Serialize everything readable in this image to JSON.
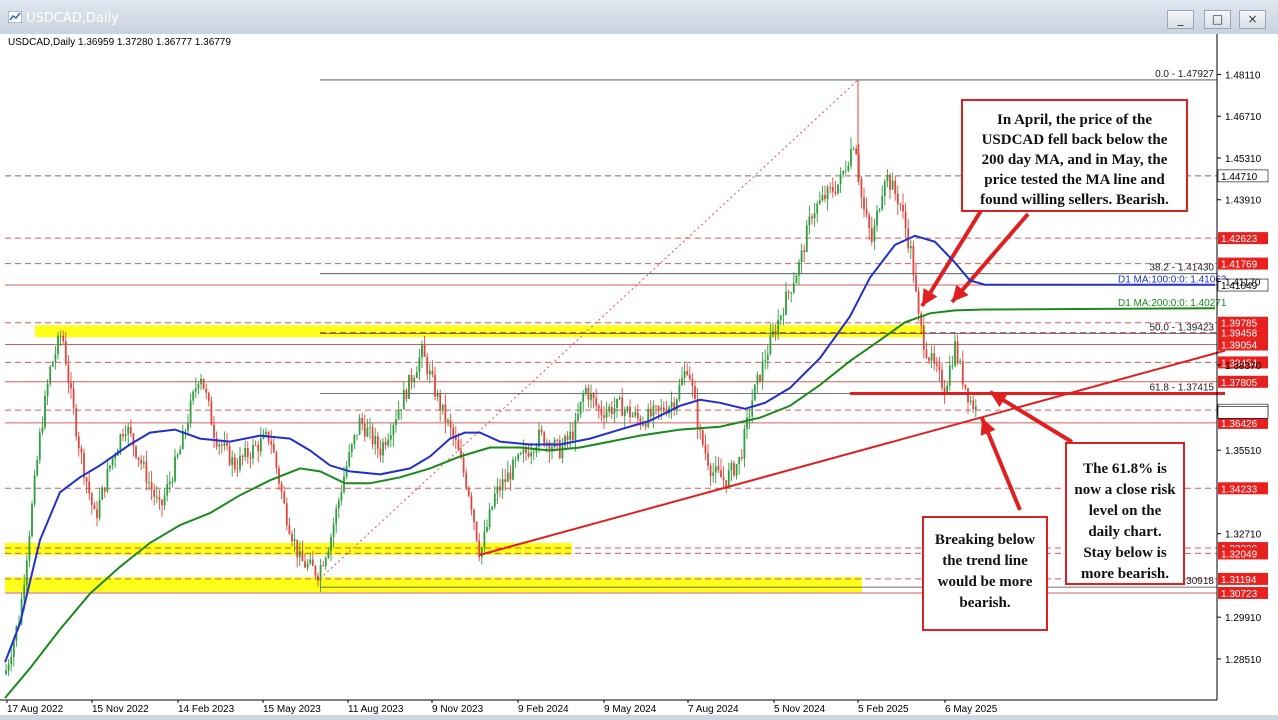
{
  "window": {
    "title": "USDCAD,Daily",
    "buttons": {
      "minimize": "_",
      "restore": "□",
      "close": "×"
    }
  },
  "chart_data": {
    "type": "line",
    "style": "candlestick",
    "symbol_header": "USDCAD,Daily  1.36959 1.37280 1.36777 1.36779",
    "ylim": [
      1.272,
      1.492
    ],
    "grid": false,
    "x_tick_labels": [
      "17 Aug 2022",
      "15 Nov 2022",
      "14 Feb 2023",
      "15 May 2023",
      "11 Aug 2023",
      "9 Nov 2023",
      "9 Feb 2024",
      "9 May 2024",
      "7 Aug 2024",
      "5 Nov 2024",
      "5 Feb 2025",
      "6 May 2025"
    ],
    "y_tick_labels": [
      "1.48110",
      "1.46710",
      "1.45310",
      "1.43910",
      "1.41170",
      "1.38370",
      "1.35510",
      "1.32710",
      "1.29910",
      "1.28510"
    ],
    "y_tick_values": [
      1.4811,
      1.4671,
      1.4531,
      1.4391,
      1.4117,
      1.3837,
      1.3551,
      1.3271,
      1.2991,
      1.2851
    ],
    "price_levels": [
      {
        "label": "1.44710",
        "value": 1.4471,
        "style": "dash",
        "color": "#555555"
      },
      {
        "label": "1.42623",
        "value": 1.42623,
        "style": "dash",
        "color": "#d04040"
      },
      {
        "label": "1.41769",
        "value": 1.41769,
        "style": "dash",
        "color": "#d04040"
      },
      {
        "label": "1.41049",
        "value": 1.41049,
        "style": "solid",
        "color": "#d04040"
      },
      {
        "label": "1.39785",
        "value": 1.39785,
        "style": "dash",
        "color": "#d04040"
      },
      {
        "label": "1.39458",
        "value": 1.39458,
        "style": "dash",
        "color": "#d04040"
      },
      {
        "label": "1.39054",
        "value": 1.39054,
        "style": "solid",
        "color": "#d04040"
      },
      {
        "label": "1.38454",
        "value": 1.38454,
        "style": "dash",
        "color": "#d04040"
      },
      {
        "label": "1.37805",
        "value": 1.37805,
        "style": "solid",
        "color": "#d04040"
      },
      {
        "label": "1.36853",
        "value": 1.36853,
        "style": "dash",
        "color": "#d04040"
      },
      {
        "label": "1.36426",
        "value": 1.36426,
        "style": "solid",
        "color": "#d04040"
      },
      {
        "label": "1.34233",
        "value": 1.34233,
        "style": "dash",
        "color": "#d04040"
      },
      {
        "label": "1.32229",
        "value": 1.32229,
        "style": "dash",
        "color": "#d04040"
      },
      {
        "label": "1.32049",
        "value": 1.32049,
        "style": "dash",
        "color": "#d04040"
      },
      {
        "label": "1.31194",
        "value": 1.31194,
        "style": "dash",
        "color": "#d04040"
      },
      {
        "label": "1.30723",
        "value": 1.30723,
        "style": "solid",
        "color": "#d04040"
      }
    ],
    "fib_levels": [
      {
        "label": "0.0 - 1.47927",
        "value": 1.47927
      },
      {
        "label": "38.2 - 1.41430",
        "value": 1.4143
      },
      {
        "label": "50.0 - 1.39423",
        "value": 1.39423
      },
      {
        "label": "61.8 - 1.37415",
        "value": 1.37415
      },
      {
        "label": "100.0 - 1.30918",
        "value": 1.30918
      }
    ],
    "ma_labels": [
      {
        "label": "D1 MA:100:0:0: 1.41063",
        "value": 1.41063,
        "color": "#1f2fd0"
      },
      {
        "label": "D1 MA:200:0:0: 1.40271",
        "value": 1.40271,
        "color": "#1a8a1a"
      }
    ],
    "current_price": {
      "label": "1.36779",
      "value": 1.36779
    },
    "highlight_levels": [
      1.4471,
      1.41049,
      1.36853
    ],
    "series": [
      {
        "name": "MA 100",
        "color": "#1f2fd0",
        "points": [
          [
            5,
            1.284
          ],
          [
            20,
            1.297
          ],
          [
            40,
            1.325
          ],
          [
            60,
            1.341
          ],
          [
            80,
            1.346
          ],
          [
            100,
            1.35
          ],
          [
            130,
            1.357
          ],
          [
            150,
            1.361
          ],
          [
            175,
            1.362
          ],
          [
            200,
            1.359
          ],
          [
            230,
            1.358
          ],
          [
            260,
            1.36
          ],
          [
            290,
            1.359
          ],
          [
            310,
            1.355
          ],
          [
            330,
            1.35
          ],
          [
            350,
            1.348
          ],
          [
            380,
            1.347
          ],
          [
            410,
            1.349
          ],
          [
            430,
            1.353
          ],
          [
            450,
            1.359
          ],
          [
            465,
            1.361
          ],
          [
            480,
            1.361
          ],
          [
            500,
            1.358
          ],
          [
            530,
            1.357
          ],
          [
            560,
            1.357
          ],
          [
            590,
            1.359
          ],
          [
            620,
            1.362
          ],
          [
            650,
            1.365
          ],
          [
            680,
            1.37
          ],
          [
            700,
            1.372
          ],
          [
            720,
            1.371
          ],
          [
            745,
            1.369
          ],
          [
            765,
            1.371
          ],
          [
            790,
            1.376
          ],
          [
            820,
            1.386
          ],
          [
            850,
            1.4
          ],
          [
            870,
            1.413
          ],
          [
            895,
            1.424
          ],
          [
            915,
            1.427
          ],
          [
            935,
            1.425
          ],
          [
            955,
            1.418
          ],
          [
            970,
            1.412
          ],
          [
            985,
            1.4106
          ],
          [
            1010,
            1.4106
          ],
          [
            1215,
            1.4106
          ]
        ]
      },
      {
        "name": "MA 200",
        "color": "#1a8a1a",
        "points": [
          [
            5,
            1.272
          ],
          [
            30,
            1.282
          ],
          [
            60,
            1.295
          ],
          [
            90,
            1.307
          ],
          [
            120,
            1.316
          ],
          [
            150,
            1.324
          ],
          [
            180,
            1.33
          ],
          [
            210,
            1.334
          ],
          [
            240,
            1.34
          ],
          [
            270,
            1.345
          ],
          [
            300,
            1.349
          ],
          [
            320,
            1.348
          ],
          [
            345,
            1.344
          ],
          [
            370,
            1.344
          ],
          [
            400,
            1.346
          ],
          [
            430,
            1.349
          ],
          [
            460,
            1.353
          ],
          [
            490,
            1.356
          ],
          [
            520,
            1.356
          ],
          [
            550,
            1.355
          ],
          [
            580,
            1.356
          ],
          [
            610,
            1.358
          ],
          [
            640,
            1.36
          ],
          [
            680,
            1.362
          ],
          [
            720,
            1.363
          ],
          [
            760,
            1.366
          ],
          [
            790,
            1.37
          ],
          [
            820,
            1.377
          ],
          [
            850,
            1.385
          ],
          [
            880,
            1.392
          ],
          [
            905,
            1.398
          ],
          [
            930,
            1.401
          ],
          [
            955,
            1.402
          ],
          [
            985,
            1.4023
          ],
          [
            1215,
            1.4027
          ]
        ]
      }
    ],
    "annotations": [
      {
        "text": "In April, the price of the USDCAD fell back below the 200 day MA, and in May, the price tested the MA line and found willing sellers. Bearish."
      },
      {
        "text": "The 61.8% is now a close risk level on the daily chart. Stay below is more bearish."
      },
      {
        "text": "Breaking below the trend line would be more bearish."
      }
    ],
    "support_zones": [
      {
        "from": 1.393,
        "to": 1.397
      },
      {
        "from": 1.32,
        "to": 1.324
      },
      {
        "from": 1.3075,
        "to": 1.3125
      }
    ],
    "trend_line": {
      "start": [
        480,
        1.32
      ],
      "end": [
        1225,
        1.3885
      ]
    },
    "resistance_61_8": {
      "start": [
        850,
        1.3741
      ],
      "end": [
        1225,
        1.3741
      ]
    },
    "fib_anchor_line": {
      "start": [
        320,
        1.312
      ],
      "end": [
        858,
        1.4793
      ]
    }
  }
}
